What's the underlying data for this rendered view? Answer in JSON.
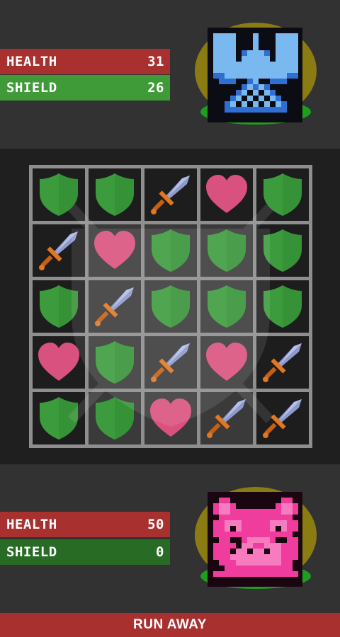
{
  "enemy": {
    "health_label": "HEALTH",
    "health_value": "31",
    "shield_label": "SHIELD",
    "shield_value": "26",
    "portrait": "blue-knight-helmet-icon"
  },
  "player": {
    "health_label": "HEALTH",
    "health_value": "50",
    "shield_label": "SHIELD",
    "shield_value": "0",
    "portrait": "pink-pig-icon"
  },
  "board": {
    "rows": [
      [
        "shield",
        "shield",
        "sword",
        "heart",
        "shield"
      ],
      [
        "sword",
        "heart",
        "shield",
        "shield",
        "shield"
      ],
      [
        "shield",
        "sword",
        "shield",
        "shield",
        "shield"
      ],
      [
        "heart",
        "shield",
        "sword",
        "heart",
        "sword"
      ],
      [
        "shield",
        "shield",
        "heart",
        "sword",
        "sword"
      ]
    ]
  },
  "colors": {
    "health_bar": "#a8302f",
    "enemy_shield_bar": "#3f9b38",
    "player_shield_bar": "#276b24",
    "shield_tile": "#3c9b3c",
    "heart_tile": "#d9517e",
    "sword_blade": "#8d9acd",
    "sword_handle": "#e3761f"
  },
  "actions": {
    "run_away_label": "RUN AWAY"
  }
}
